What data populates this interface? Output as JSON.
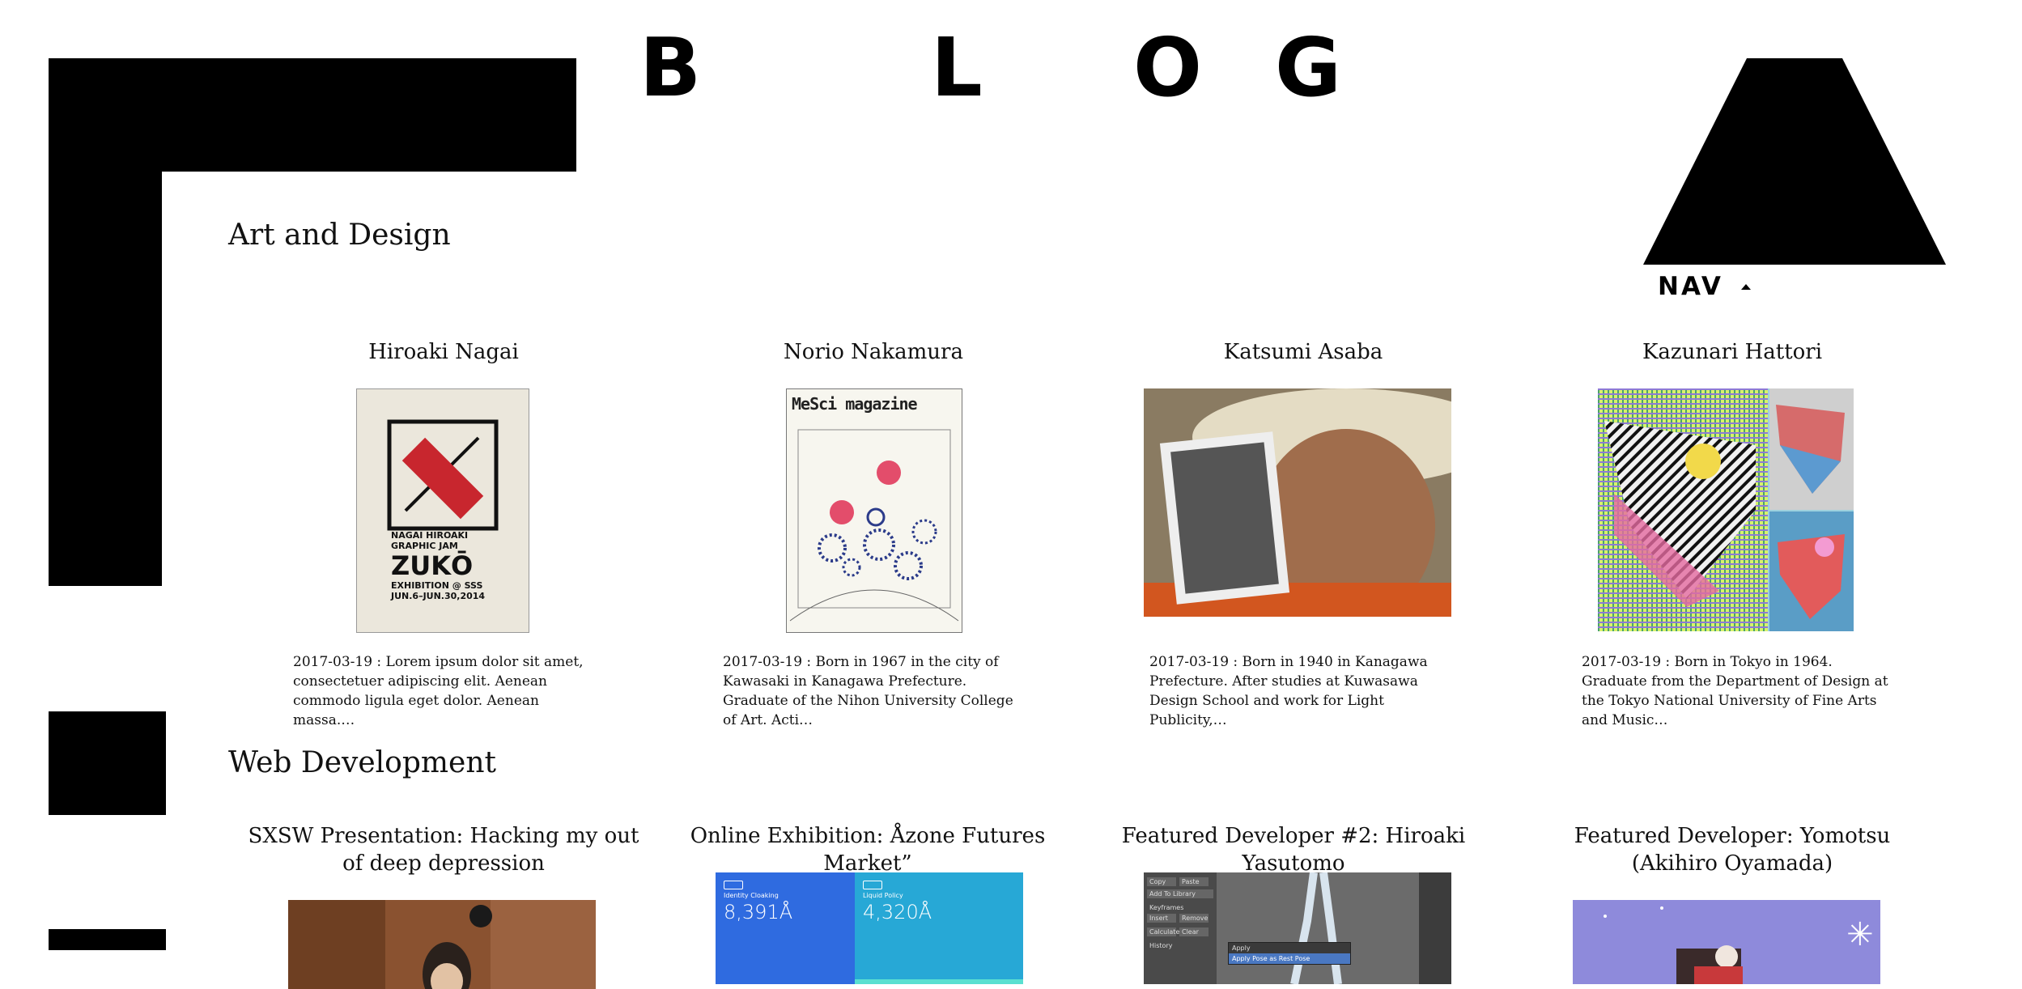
{
  "logo": {
    "letters": [
      "B",
      "L",
      "O",
      "G"
    ]
  },
  "nav": {
    "label": "NAV"
  },
  "sections": [
    {
      "title": "Art and Design",
      "posts": [
        {
          "title": "Hiroaki Nagai",
          "excerpt": "2017-03-19 : Lorem ipsum dolor sit amet, consectetuer adipiscing elit. Aenean commodo ligula eget dolor. Aenean massa.…",
          "thumb_text": [
            "NAGAI HIROAKI",
            "GRAPHIC JAM",
            "ZUKŌ",
            "EXHIBITION @ SSS",
            "JUN.6–JUN.30,2014"
          ]
        },
        {
          "title": "Norio Nakamura",
          "excerpt": "2017-03-19 : Born in 1967 in the city of Kawasaki in Kanagawa Prefecture. Graduate of the Nihon University College of Art. Acti…",
          "thumb_text": [
            "MeSci magazine"
          ]
        },
        {
          "title": "Katsumi Asaba",
          "excerpt": "2017-03-19 : Born in 1940 in Kanagawa Prefecture. After studies at Kuwasawa Design School and work for Light Publicity,…"
        },
        {
          "title": "Kazunari Hattori",
          "excerpt": "2017-03-19 : Born in Tokyo in 1964. Graduate from the Department of Design at the Tokyo National University of Fine Arts and Music…"
        }
      ]
    },
    {
      "title": "Web Development",
      "posts": [
        {
          "title": "SXSW Presentation: Hacking my out of deep depression"
        },
        {
          "title": "Online Exhibition: Åzone Futures Market”",
          "thumb_text": [
            "Identity Cloaking",
            "8,391Å",
            "Liquid Policy",
            "4,320Å"
          ]
        },
        {
          "title": "Featured Developer #2: Hiroaki Yasutomo",
          "thumb_text": [
            "Copy",
            "Paste",
            "Add To Library",
            "Keyframes",
            "Insert",
            "Remove",
            "Calculate",
            "Clear",
            "History",
            "Apply",
            "Apply Pose as Rest Pose"
          ]
        },
        {
          "title": "Featured Developer: Yomotsu (Akihiro Oyamada)"
        }
      ]
    }
  ]
}
